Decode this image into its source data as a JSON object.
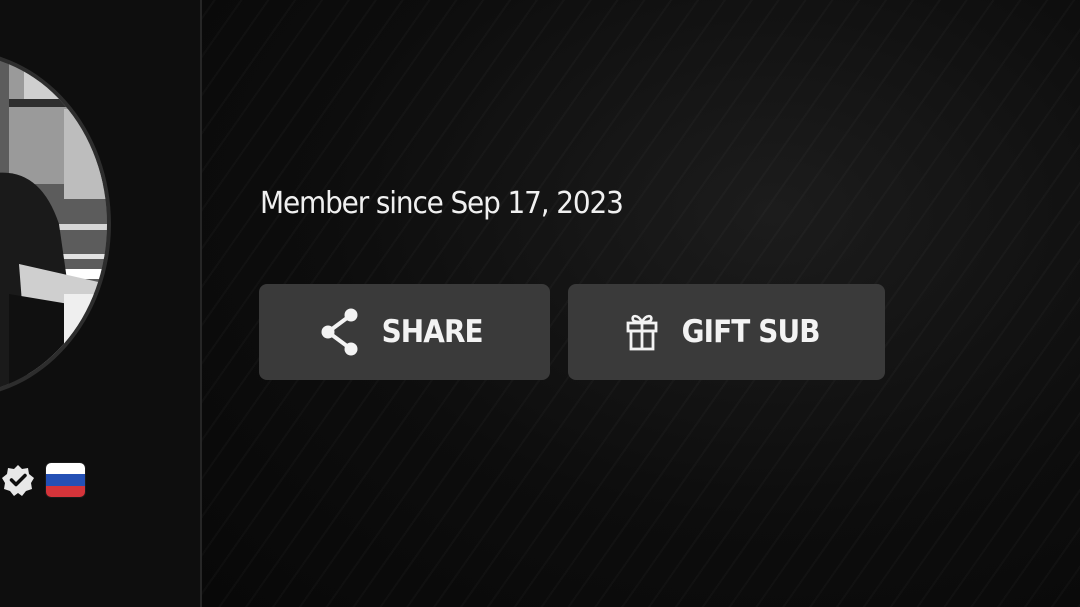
{
  "profile": {
    "member_since": "Member since Sep 17, 2023",
    "badges": {
      "verified_icon": "verified-badge-icon",
      "country_flag": {
        "icon": "russia-flag-icon",
        "colors": [
          "#ffffff",
          "#2450b5",
          "#d4343a"
        ]
      }
    }
  },
  "actions": {
    "share": {
      "label": "SHARE",
      "icon": "share-icon"
    },
    "gift_sub": {
      "label": "GIFT SUB",
      "icon": "gift-icon"
    }
  },
  "colors": {
    "background": "#0b0b0b",
    "button_bg": "#3a3a3a",
    "text": "#f0f0f0",
    "divider": "#262626"
  }
}
